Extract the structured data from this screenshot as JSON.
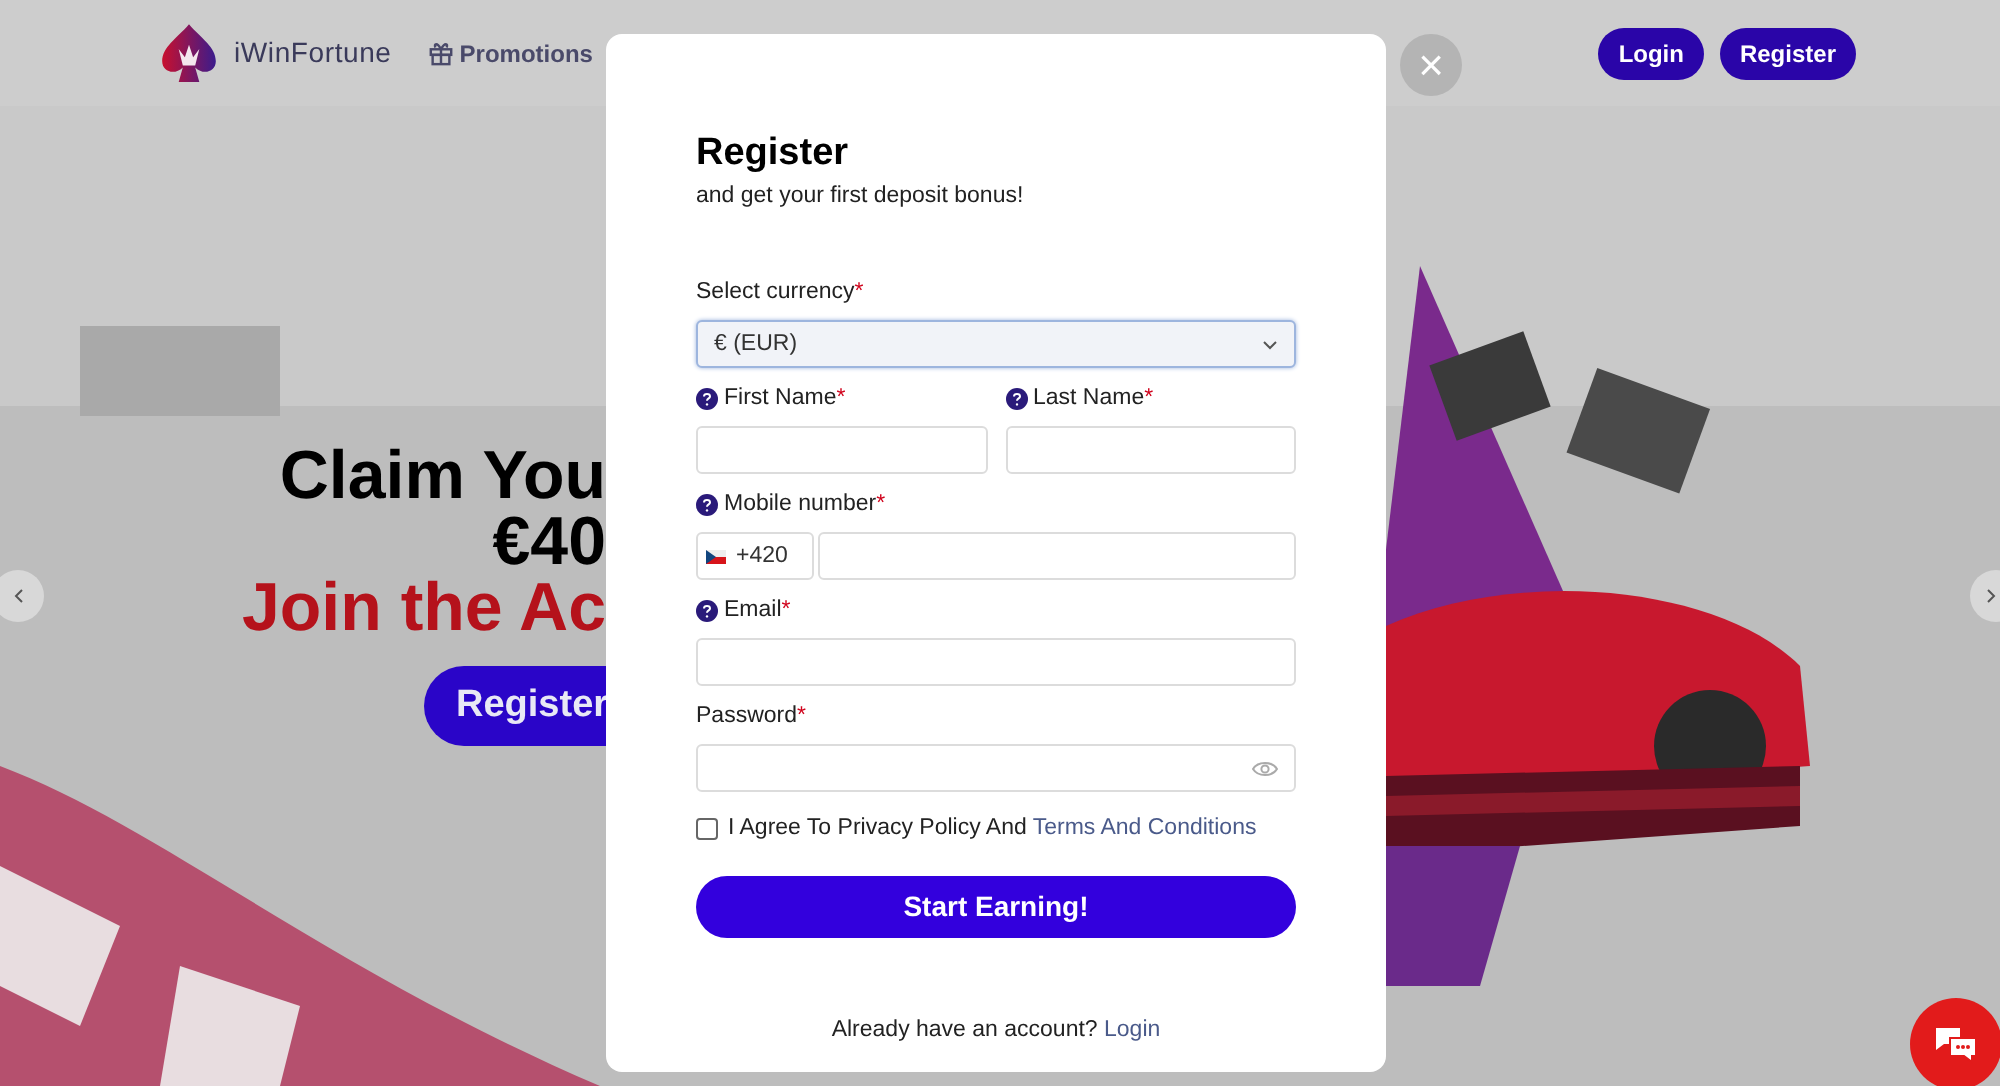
{
  "header": {
    "logo_text": "iWinFortune",
    "nav": [
      {
        "label": "Promotions"
      }
    ],
    "buttons": [
      {
        "label": "Login"
      },
      {
        "label": "Register"
      }
    ]
  },
  "hero": {
    "lines": [
      {
        "text": "Claim You",
        "kind": "dark"
      },
      {
        "text": "€40",
        "kind": "dark"
      },
      {
        "text": "Join the Ac",
        "kind": "accent"
      }
    ],
    "cta": "Register"
  },
  "modal": {
    "close": "×",
    "title": "Register",
    "subtitle": "and get your first deposit bonus!",
    "fields": [
      {
        "kind": "select",
        "label": "Select currency",
        "required_mark": "*",
        "help_icon": false,
        "value": "€ (EUR)"
      },
      {
        "kind": "pair",
        "items": [
          {
            "label": "First Name",
            "required_mark": "*",
            "help_icon": true
          },
          {
            "label": "Last Name",
            "required_mark": "*",
            "help_icon": true
          }
        ]
      },
      {
        "kind": "phone",
        "label": "Mobile number",
        "required_mark": "*",
        "help_icon": true,
        "prefix": "+420"
      },
      {
        "kind": "text",
        "label": "Email",
        "required_mark": "*",
        "help_icon": true
      },
      {
        "kind": "password",
        "label": "Password",
        "required_mark": "*",
        "help_icon": false
      }
    ],
    "agree": {
      "checked": false,
      "text": "I Agree To Privacy Policy And",
      "link": "Terms And Conditions"
    },
    "submit": "Start Earning!",
    "footer": {
      "text": "Already have an account?",
      "link": "Login"
    }
  }
}
